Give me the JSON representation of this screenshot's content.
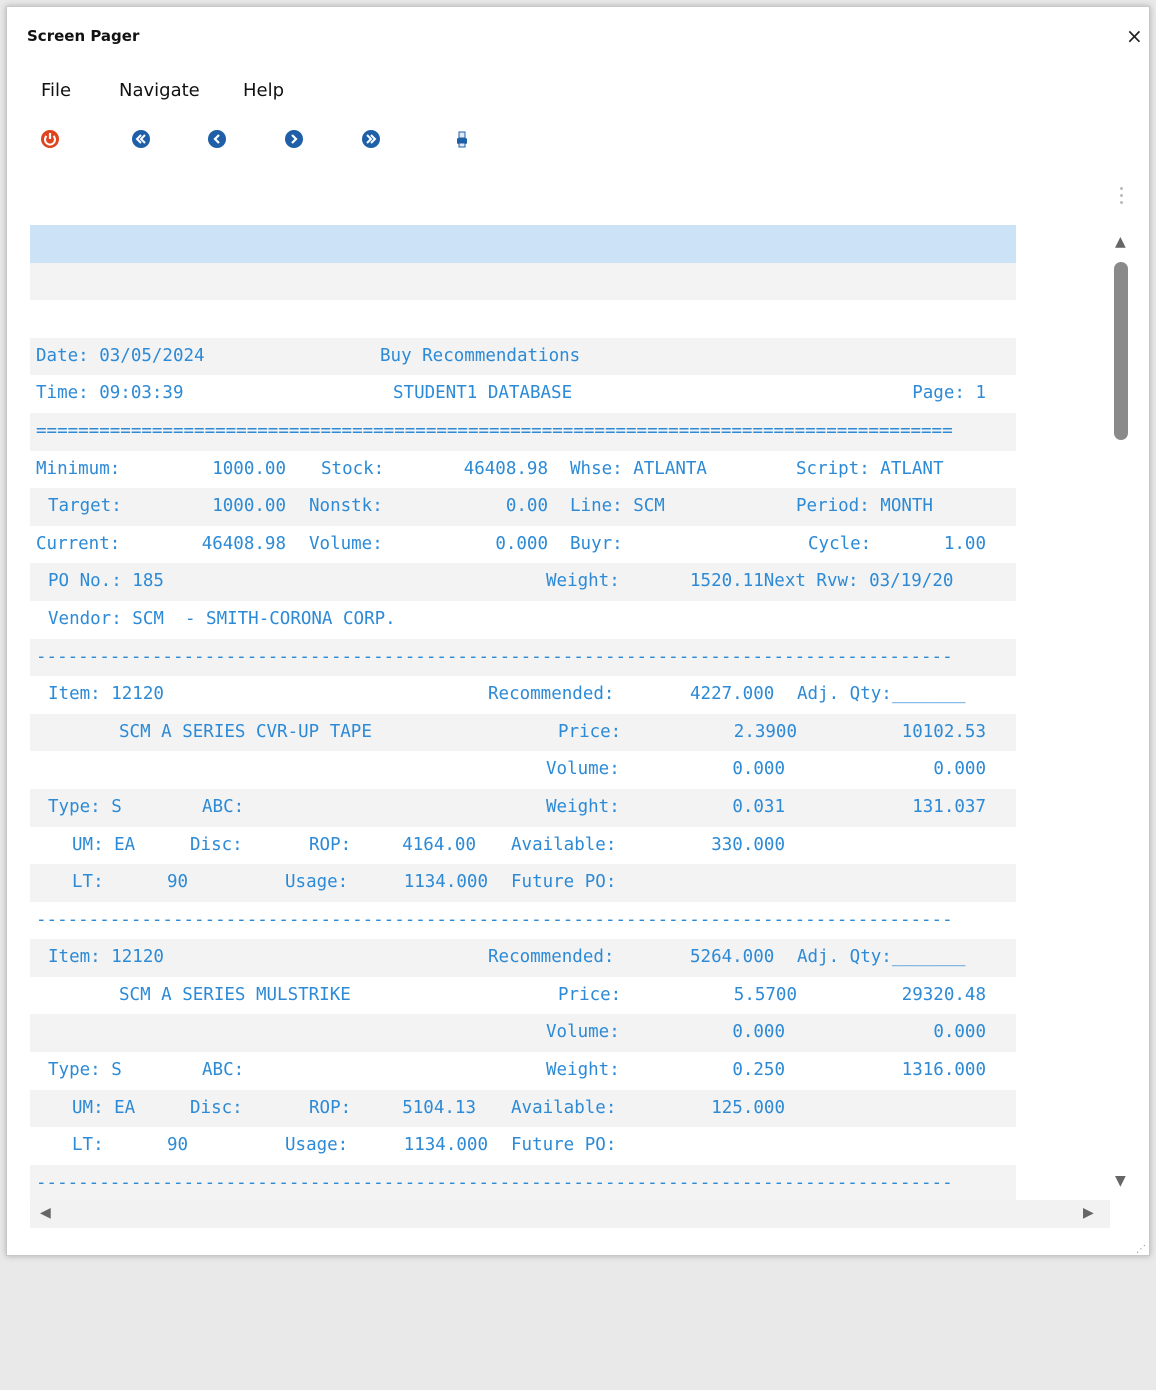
{
  "window": {
    "title": "Screen Pager",
    "close": "×"
  },
  "menu": [
    "File",
    "Navigate",
    "Help"
  ],
  "toolbar": [
    {
      "name": "power-icon",
      "color": "#d83a1f"
    },
    {
      "name": "first-page-icon",
      "color": "#1f5fa8"
    },
    {
      "name": "previous-page-icon",
      "color": "#1f5fa8"
    },
    {
      "name": "next-page-icon",
      "color": "#1f5fa8"
    },
    {
      "name": "last-page-icon",
      "color": "#1f5fa8"
    },
    {
      "name": "print-icon",
      "color": "#1f5fa8"
    }
  ],
  "report": {
    "date": "Date: 03/05/2024",
    "title": "Buy Recommendations",
    "time": "Time: 09:03:39",
    "database": "STUDENT1 DATABASE",
    "page": "Page: 1",
    "double_rule": "=======================================================================================",
    "rule": "---------------------------------------------------------------------------------------",
    "minimum_label": "Minimum:",
    "minimum": "1000.00",
    "stock_label": "Stock:",
    "stock": "46408.98",
    "whse": "Whse: ATLANTA",
    "script": "Script: ATLANT",
    "target_label": "Target:",
    "target": "1000.00",
    "nonstk_label": "Nonstk:",
    "nonstk": "0.00",
    "line": "Line: SCM",
    "period": "Period: MONTH",
    "current_label": "Current:",
    "current": "46408.98",
    "volume_label": "Volume:",
    "volume": "0.000",
    "buyr": "Buyr:",
    "cycle_label": "Cycle:",
    "cycle": "1.00",
    "po": "PO No.: 185",
    "weight_label": "Weight:",
    "weight": "1520.11Next Rvw: 03/19/20",
    "vendor": "Vendor: SCM  - SMITH-CORONA CORP."
  },
  "items": [
    {
      "item": "Item: 12120",
      "desc": "SCM A SERIES CVR-UP TAPE",
      "recommended": "4227.000",
      "adj": "Adj. Qty:_______",
      "price": "2.3900",
      "price_ext": "10102.53",
      "volume": "0.000",
      "volume_ext": "0.000",
      "type": "Type: S",
      "abc": "ABC:",
      "weight": "0.031",
      "weight_ext": "131.037",
      "um": "UM: EA",
      "disc": "Disc:",
      "rop_label": "ROP:",
      "rop": "4164.00",
      "available": "330.000",
      "lt_label": "LT:",
      "lt": "90",
      "usage_label": "Usage:",
      "usage": "1134.000",
      "future_po": "Future PO:"
    },
    {
      "item": "Item: 12120",
      "desc": "SCM A SERIES MULSTRIKE",
      "recommended": "5264.000",
      "adj": "Adj. Qty:_______",
      "price": "5.5700",
      "price_ext": "29320.48",
      "volume": "0.000",
      "volume_ext": "0.000",
      "type": "Type: S",
      "abc": "ABC:",
      "weight": "0.250",
      "weight_ext": "1316.000",
      "um": "UM: EA",
      "disc": "Disc:",
      "rop_label": "ROP:",
      "rop": "5104.13",
      "available": "125.000",
      "lt_label": "LT:",
      "lt": "90",
      "usage_label": "Usage:",
      "usage": "1134.000",
      "future_po": "Future PO:"
    }
  ],
  "labels": {
    "recommended": "Recommended:",
    "price": "Price:",
    "volume": "Volume:",
    "weight": "Weight:",
    "available": "Available:"
  }
}
